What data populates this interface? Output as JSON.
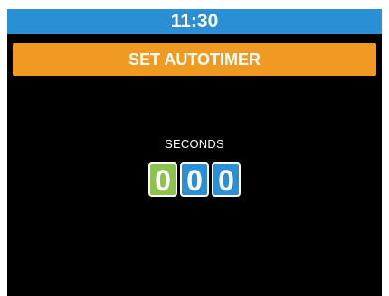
{
  "status_bar": {
    "time": "11:30"
  },
  "header": {
    "title": "SET AUTOTIMER"
  },
  "timer": {
    "unit_label": "SECONDS",
    "digits": [
      "0",
      "0",
      "0"
    ],
    "active_digit_index": 0
  },
  "colors": {
    "status_bar": "#2b8fd6",
    "header": "#f09a22",
    "digit_active": "#8cc34a",
    "digit_inactive": "#2b8fd6",
    "screen_background": "#000000"
  }
}
